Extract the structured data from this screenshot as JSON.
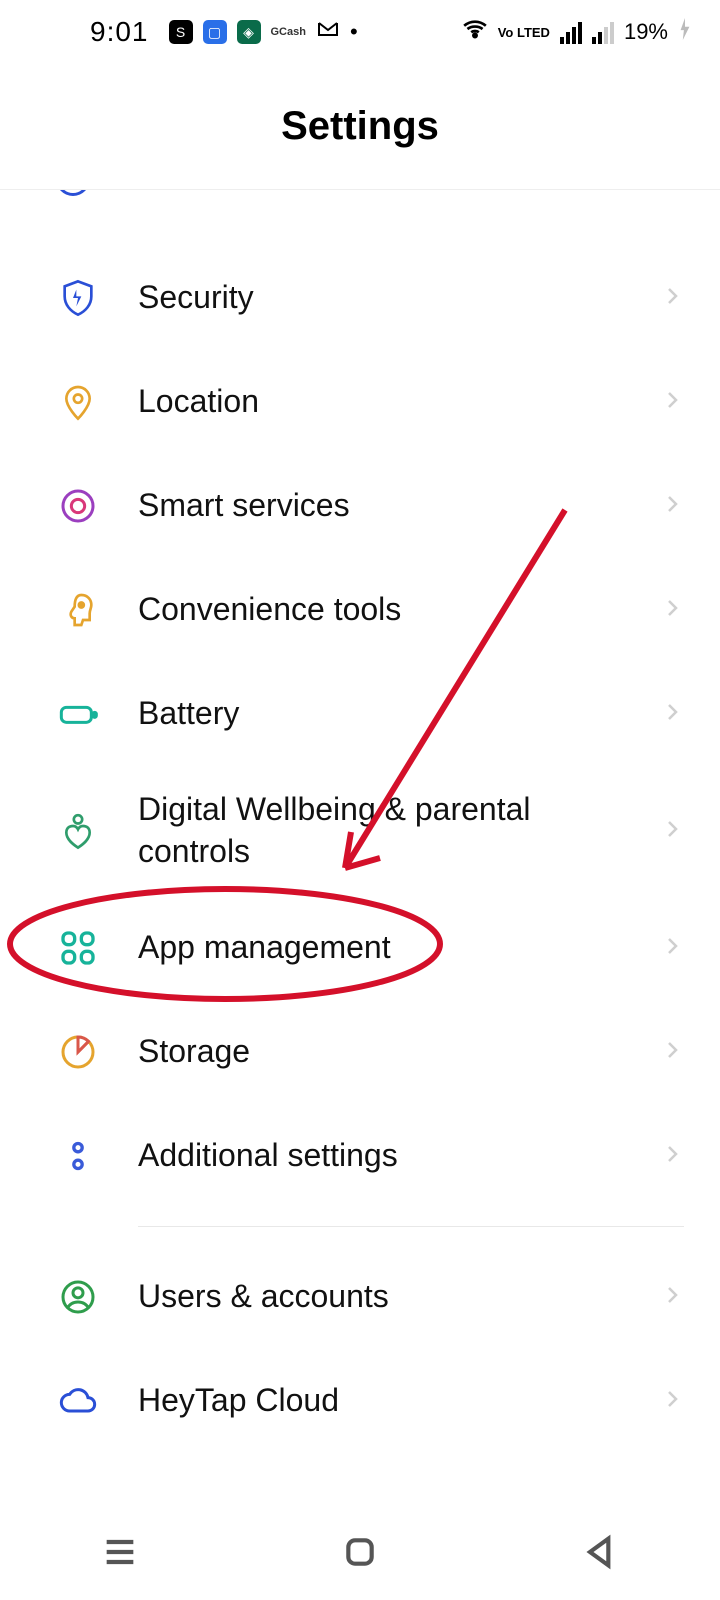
{
  "status": {
    "time": "9:01",
    "battery": "19%",
    "volte": "Vo LTED"
  },
  "title": "Settings",
  "items": [
    {
      "id": "security",
      "label": "Security"
    },
    {
      "id": "location",
      "label": "Location"
    },
    {
      "id": "smart-services",
      "label": "Smart services"
    },
    {
      "id": "convenience-tools",
      "label": "Convenience tools"
    },
    {
      "id": "battery",
      "label": "Battery"
    },
    {
      "id": "digital-wellbeing",
      "label": "Digital Wellbeing & parental controls"
    },
    {
      "id": "app-management",
      "label": "App management"
    },
    {
      "id": "storage",
      "label": "Storage"
    },
    {
      "id": "additional-settings",
      "label": "Additional settings"
    },
    {
      "id": "users-accounts",
      "label": "Users & accounts"
    },
    {
      "id": "heytap-cloud",
      "label": "HeyTap Cloud"
    }
  ],
  "annotation": {
    "target_item": "app-management",
    "shape": "ellipse-with-arrow",
    "color": "#d4102a"
  }
}
